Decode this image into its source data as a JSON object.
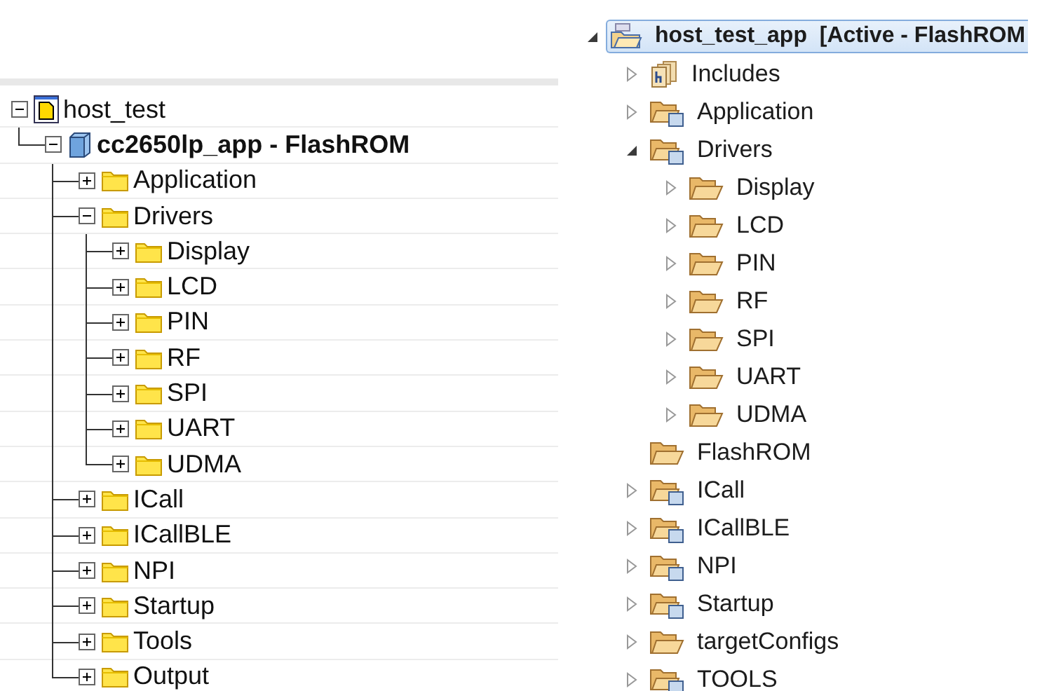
{
  "left_tree": {
    "items": [
      {
        "label": "host_test",
        "kind": "workspace",
        "expanded": true,
        "children": [
          {
            "label": "cc2650lp_app - FlashROM",
            "kind": "project",
            "expanded": true,
            "children": [
              {
                "label": "Application",
                "kind": "folder",
                "expanded": false
              },
              {
                "label": "Drivers",
                "kind": "folder",
                "expanded": true,
                "children": [
                  {
                    "label": "Display",
                    "kind": "folder",
                    "expanded": false
                  },
                  {
                    "label": "LCD",
                    "kind": "folder",
                    "expanded": false
                  },
                  {
                    "label": "PIN",
                    "kind": "folder",
                    "expanded": false
                  },
                  {
                    "label": "RF",
                    "kind": "folder",
                    "expanded": false
                  },
                  {
                    "label": "SPI",
                    "kind": "folder",
                    "expanded": false
                  },
                  {
                    "label": "UART",
                    "kind": "folder",
                    "expanded": false
                  },
                  {
                    "label": "UDMA",
                    "kind": "folder",
                    "expanded": false
                  }
                ]
              },
              {
                "label": "ICall",
                "kind": "folder",
                "expanded": false
              },
              {
                "label": "ICallBLE",
                "kind": "folder",
                "expanded": false
              },
              {
                "label": "NPI",
                "kind": "folder",
                "expanded": false
              },
              {
                "label": "Startup",
                "kind": "folder",
                "expanded": false
              },
              {
                "label": "Tools",
                "kind": "folder",
                "expanded": false
              },
              {
                "label": "Output",
                "kind": "folder",
                "expanded": false
              }
            ]
          }
        ]
      }
    ]
  },
  "right_tree": {
    "items": [
      {
        "label": "host_test_app  [Active - FlashROM",
        "kind": "project",
        "expanded": true,
        "selected": true,
        "children": [
          {
            "label": "Includes",
            "kind": "includes",
            "expanded": false,
            "selected": false
          },
          {
            "label": "Application",
            "kind": "linked-folder",
            "expanded": false,
            "selected": false
          },
          {
            "label": "Drivers",
            "kind": "linked-folder",
            "expanded": true,
            "selected": false,
            "children": [
              {
                "label": "Display",
                "kind": "folder",
                "expanded": false,
                "selected": false
              },
              {
                "label": "LCD",
                "kind": "folder",
                "expanded": false,
                "selected": false
              },
              {
                "label": "PIN",
                "kind": "folder",
                "expanded": false,
                "selected": false
              },
              {
                "label": "RF",
                "kind": "folder",
                "expanded": false,
                "selected": false
              },
              {
                "label": "SPI",
                "kind": "folder",
                "expanded": false,
                "selected": false
              },
              {
                "label": "UART",
                "kind": "folder",
                "expanded": false,
                "selected": false
              },
              {
                "label": "UDMA",
                "kind": "folder",
                "expanded": false,
                "selected": false
              }
            ]
          },
          {
            "label": "FlashROM",
            "kind": "folder",
            "selected": false
          },
          {
            "label": "ICall",
            "kind": "linked-folder",
            "expanded": false,
            "selected": false
          },
          {
            "label": "ICallBLE",
            "kind": "linked-folder",
            "expanded": false,
            "selected": false
          },
          {
            "label": "NPI",
            "kind": "linked-folder",
            "expanded": false,
            "selected": false
          },
          {
            "label": "Startup",
            "kind": "linked-folder",
            "expanded": false,
            "selected": false
          },
          {
            "label": "targetConfigs",
            "kind": "folder",
            "expanded": false,
            "selected": false
          },
          {
            "label": "TOOLS",
            "kind": "linked-folder",
            "expanded": false,
            "selected": false
          }
        ]
      }
    ]
  }
}
